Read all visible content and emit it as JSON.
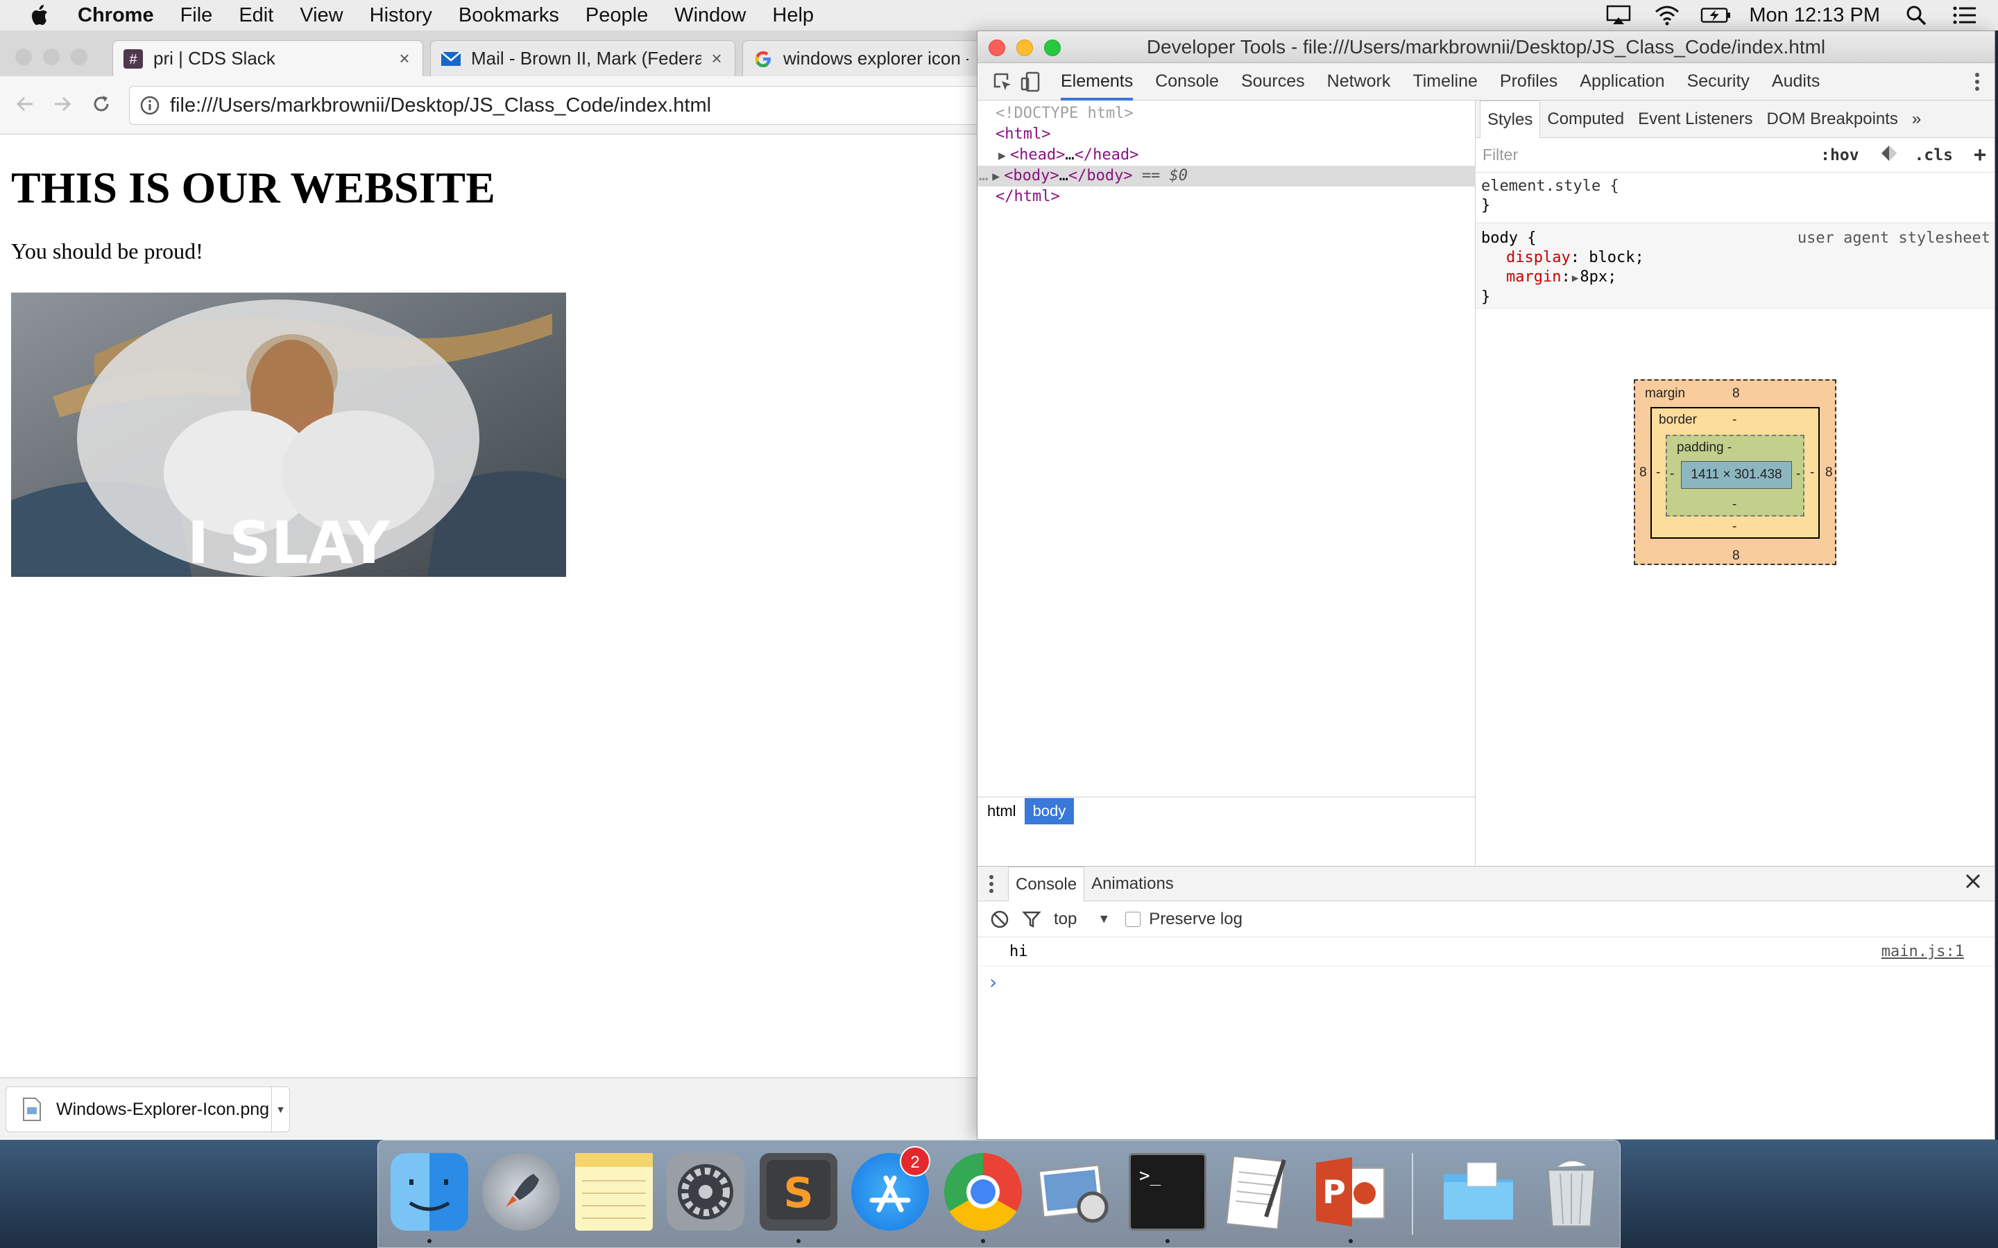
{
  "menubar": {
    "app": "Chrome",
    "items": [
      "File",
      "Edit",
      "View",
      "History",
      "Bookmarks",
      "People",
      "Window",
      "Help"
    ],
    "clock": "Mon 12:13 PM"
  },
  "browser": {
    "tabs": [
      {
        "title": "pri | CDS Slack",
        "icon": "slack-hash-icon"
      },
      {
        "title": "Mail - Brown II, Mark (Federal)",
        "icon": "mail-icon"
      },
      {
        "title": "windows explorer icon -",
        "icon": "google-icon"
      }
    ],
    "url": "file:///Users/markbrownii/Desktop/JS_Class_Code/index.html",
    "page": {
      "heading": "THIS IS OUR WEBSITE",
      "paragraph": "You should be proud!",
      "image_caption": "I SLAY"
    },
    "download": {
      "filename": "Windows-Explorer-Icon.png"
    }
  },
  "devtools": {
    "title": "Developer Tools - file:///Users/markbrownii/Desktop/JS_Class_Code/index.html",
    "tabs": [
      "Elements",
      "Console",
      "Sources",
      "Network",
      "Timeline",
      "Profiles",
      "Application",
      "Security",
      "Audits"
    ],
    "selected_tab": "Elements",
    "dom": {
      "doctype": "<!DOCTYPE html>",
      "html_open": "<html>",
      "head": "head",
      "body": "body",
      "ellipsis": "…",
      "selected_marker": "== $0",
      "html_close": "</html>",
      "dots": "…"
    },
    "breadcrumbs": [
      "html",
      "body"
    ],
    "styles": {
      "tabs": [
        "Styles",
        "Computed",
        "Event Listeners",
        "DOM Breakpoints"
      ],
      "more": "»",
      "filter_placeholder": "Filter",
      "hov": ":hov",
      "cls": ".cls",
      "plus": "+",
      "element_style": "element.style {",
      "close_brace": "}",
      "body_selector": "body {",
      "source": "user agent stylesheet",
      "props": [
        {
          "name": "display",
          "value": "block;"
        },
        {
          "name": "margin",
          "value": "8px;"
        }
      ]
    },
    "box_model": {
      "margin_label": "margin",
      "margin_top": "8",
      "margin_bottom": "8",
      "margin_left": "8",
      "margin_right": "8",
      "border_label": "border",
      "border_top": "-",
      "border_bottom": "-",
      "border_left": "-",
      "border_right": "-",
      "padding_label": "padding -",
      "padding_bottom": "-",
      "padding_left": "-",
      "padding_right": "-",
      "content": "1411 × 301.438"
    },
    "console": {
      "tabs": [
        "Console",
        "Animations"
      ],
      "context": "top",
      "preserve_log": "Preserve log",
      "message": "hi",
      "source": "main.js:1",
      "prompt": "›"
    }
  },
  "dock": {
    "apps": [
      "finder-icon",
      "launchpad-icon",
      "notes-icon",
      "system-preferences-icon",
      "sublime-text-icon",
      "app-store-icon",
      "chrome-icon",
      "preview-icon",
      "terminal-icon",
      "textedit-icon",
      "powerpoint-icon",
      "folder-icon",
      "trash-icon"
    ],
    "app_store_badge": "2",
    "sublime_letter": "S",
    "terminal_prompt": ">_",
    "powerpoint_letter": "P"
  },
  "colors": {
    "accent": "#3879d9",
    "tag": "#881280",
    "prop": "#c80000",
    "margin": "#f9cc9d",
    "border": "#fddd9b",
    "padding": "#c3d08b",
    "content": "#8cb6c0"
  }
}
